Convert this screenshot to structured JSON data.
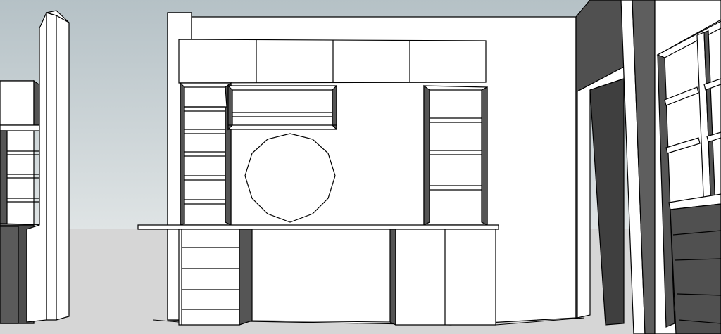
{
  "scene": {
    "sky_color": "#c9d1d4",
    "sky_color_top": "#b9c4c8",
    "ground_color": "#d6d6d6",
    "wall_color": "#ffffff",
    "shadow_color": "#4a4a4a",
    "edge_color": "#000000"
  }
}
